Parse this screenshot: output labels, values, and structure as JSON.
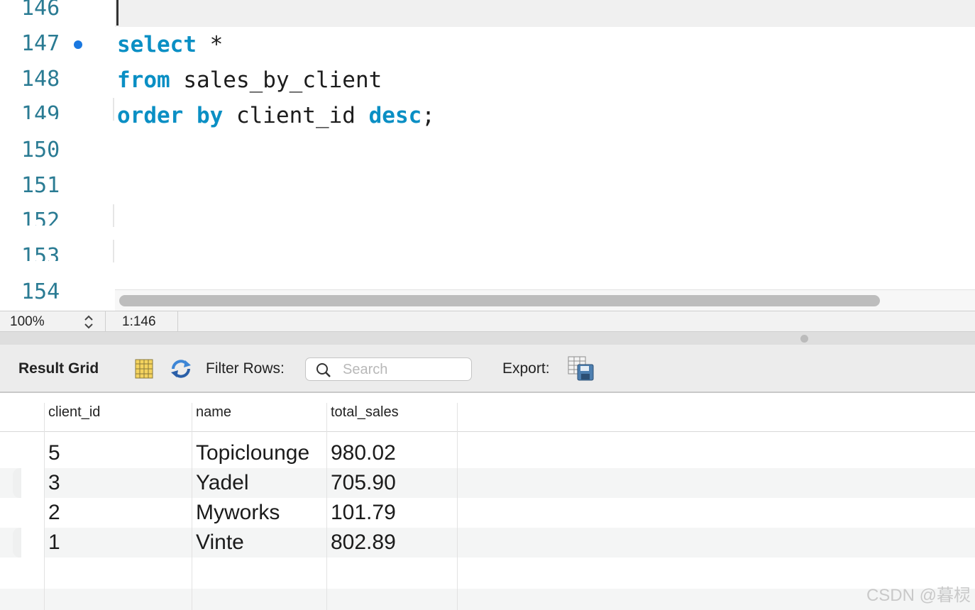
{
  "editor": {
    "line_numbers": [
      "146",
      "147",
      "148",
      "149",
      "150",
      "151",
      "152",
      "153",
      "154"
    ],
    "code": {
      "line1_kw": "select",
      "line1_rest": " *",
      "line2_kw": "from",
      "line2_rest": " sales_by_client",
      "line3_kw1": "order by",
      "line3_mid": " client_id ",
      "line3_kw2": "desc",
      "line3_end": ";"
    }
  },
  "status_bar": {
    "zoom": "100%",
    "cursor_position": "1:146"
  },
  "result_toolbar": {
    "title": "Result Grid",
    "filter_label": "Filter Rows:",
    "search_placeholder": "Search",
    "export_label": "Export:",
    "icons": [
      "grid-layout-icon",
      "refresh-icon",
      "search-icon",
      "export-save-icon"
    ]
  },
  "result_grid": {
    "columns": [
      "client_id",
      "name",
      "total_sales"
    ],
    "rows": [
      {
        "client_id": "5",
        "name": "Topiclounge",
        "total_sales": "980.02"
      },
      {
        "client_id": "3",
        "name": "Yadel",
        "total_sales": "705.90"
      },
      {
        "client_id": "2",
        "name": "Myworks",
        "total_sales": "101.79"
      },
      {
        "client_id": "1",
        "name": "Vinte",
        "total_sales": "802.89"
      }
    ]
  },
  "watermark": "CSDN @暮棂",
  "colors": {
    "keyword": "#0a8fc4",
    "line_number": "#2a7b93",
    "breakpoint": "#1a78e0"
  }
}
